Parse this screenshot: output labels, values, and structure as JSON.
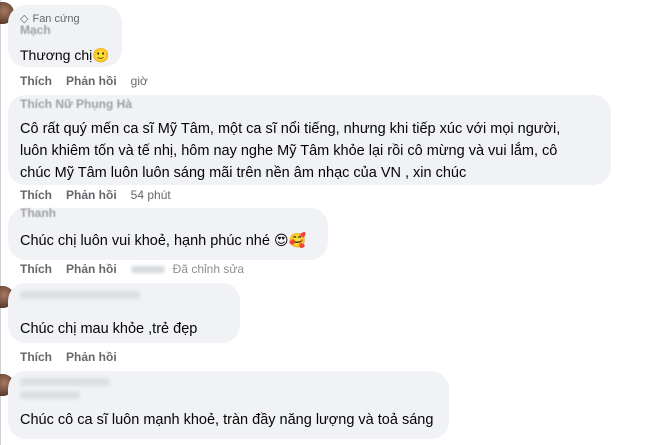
{
  "comments": [
    {
      "badge": "Fan cứng",
      "badge_icon": "gem-icon",
      "author": "Mạch",
      "text": "Thương chị",
      "emoji": "🙂",
      "actions": {
        "like": "Thích",
        "reply": "Phản hồi",
        "time": "giờ"
      }
    },
    {
      "author": "Thích Nữ Phụng Hà",
      "lines": [
        "Cô rất quý mến ca sĩ Mỹ Tâm, một ca sĩ nổi tiếng, nhưng khi tiếp xúc với mọi người,",
        "luôn khiêm tốn và tế nhị, hôm nay nghe Mỹ Tâm khỏe lại rồi cô mừng và vui lắm, cô",
        "chúc Mỹ Tâm luôn luôn sáng mãi trên nền âm nhạc của VN , xin chúc"
      ],
      "actions": {
        "like": "Thích",
        "reply": "Phản hồi",
        "time": "54 phút"
      }
    },
    {
      "author": "Thanh",
      "text": "Chúc chị luôn vui khoẻ, hạnh phúc nhé",
      "emoji": "😍🥰",
      "actions": {
        "like": "Thích",
        "reply": "Phản hồi",
        "edited": "Đã chỉnh sửa"
      }
    },
    {
      "author": "",
      "text": "Chúc chị mau khỏe ,trẻ đẹp",
      "actions": {
        "like": "Thích",
        "reply": "Phản hồi"
      }
    },
    {
      "badge": "Fan cứng",
      "author": "",
      "text": "Chúc cô ca sĩ luôn mạnh khoẻ, tràn đầy năng lượng và toả sáng"
    }
  ]
}
